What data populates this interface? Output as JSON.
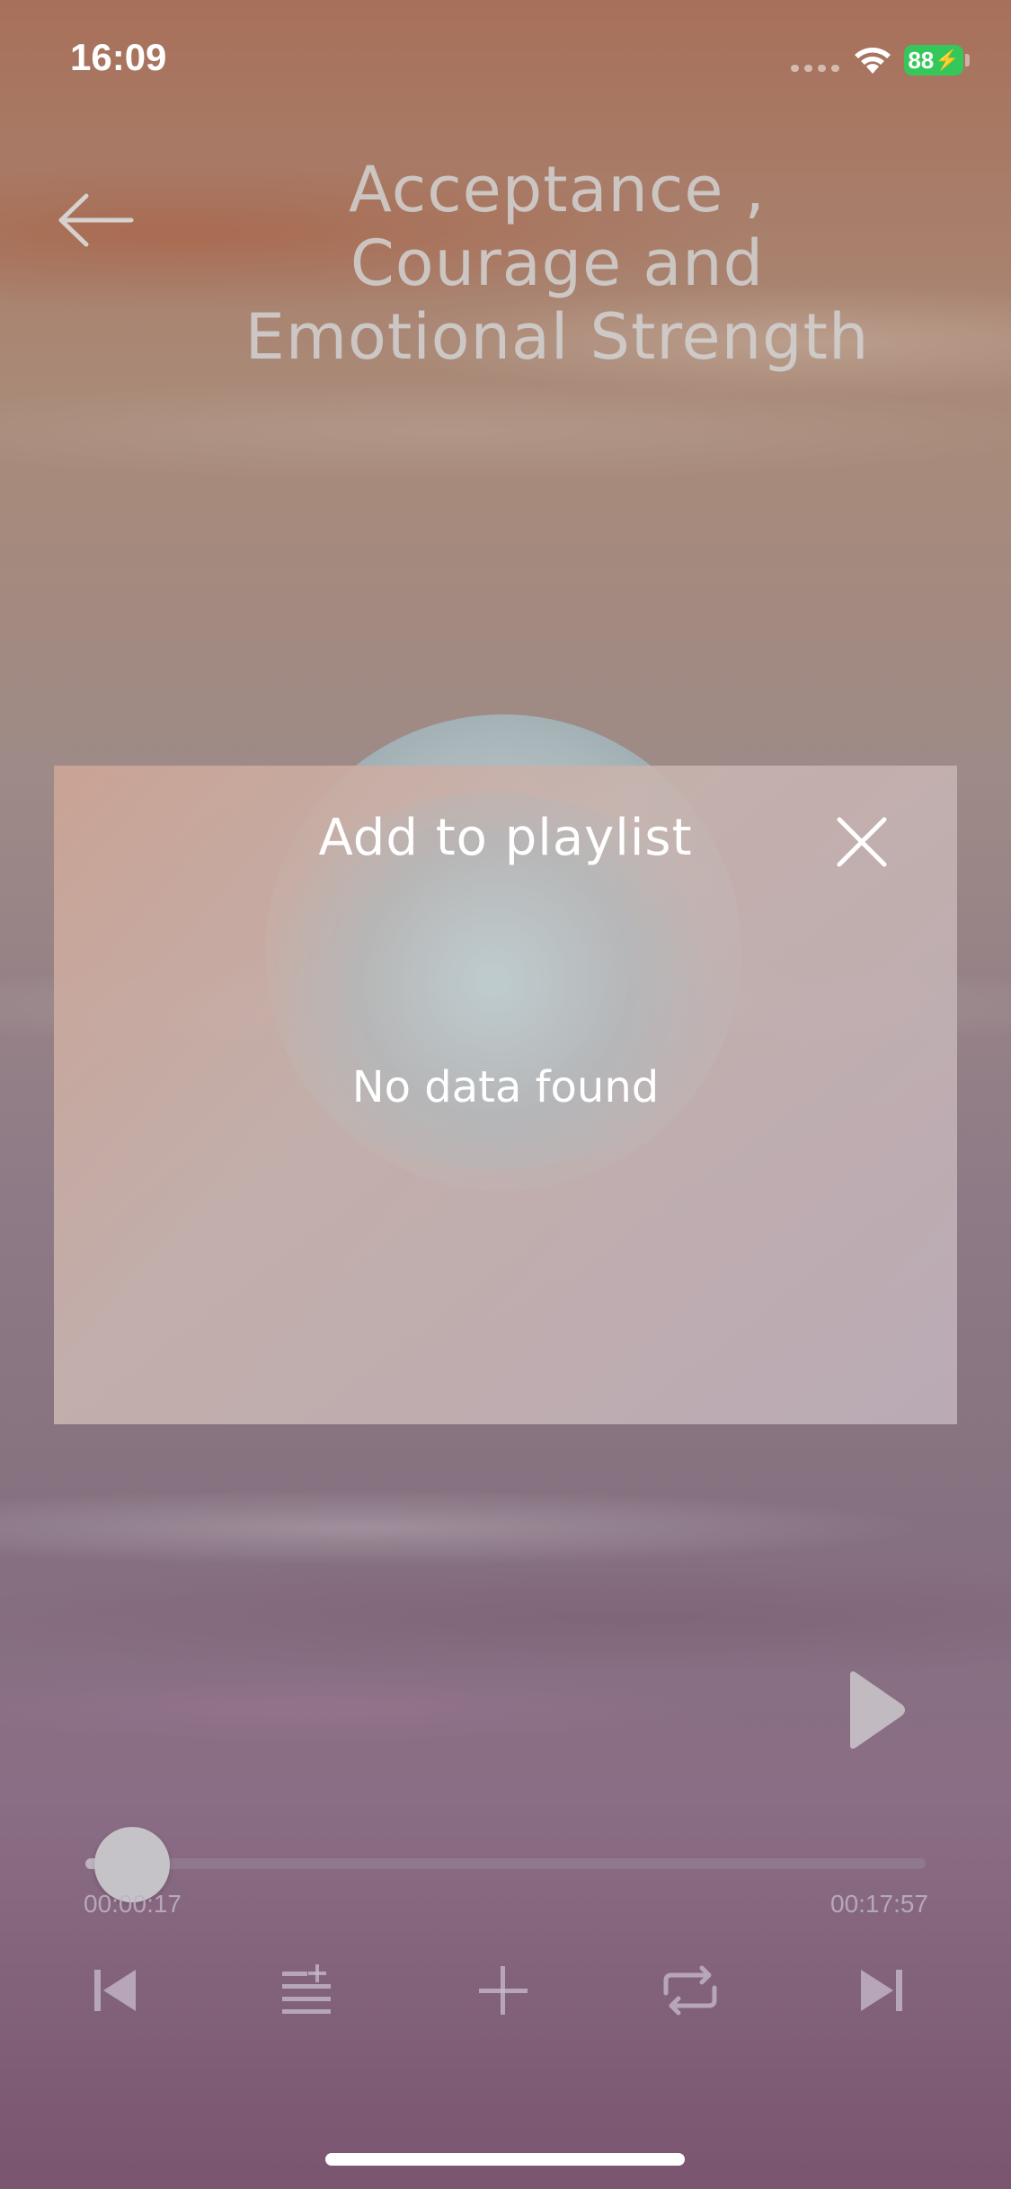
{
  "status_bar": {
    "time": "16:09",
    "battery": "88",
    "battery_color": "#34c759",
    "icons": [
      "cellular-dots-icon",
      "wifi-icon",
      "battery-charging-icon"
    ]
  },
  "header": {
    "back_icon": "arrow-left-icon",
    "title": "Acceptance , Courage and Emotional Strength"
  },
  "modal": {
    "title": "Add to playlist",
    "close_icon": "close-icon",
    "empty_message": "No data found"
  },
  "player": {
    "play_icon": "play-icon",
    "elapsed": "00:00:17",
    "total": "00:17:57",
    "progress_fraction": 0.016,
    "controls": [
      {
        "name": "skip-previous-icon"
      },
      {
        "name": "playlist-add-icon"
      },
      {
        "name": "plus-icon"
      },
      {
        "name": "repeat-icon"
      },
      {
        "name": "skip-next-icon"
      }
    ]
  }
}
